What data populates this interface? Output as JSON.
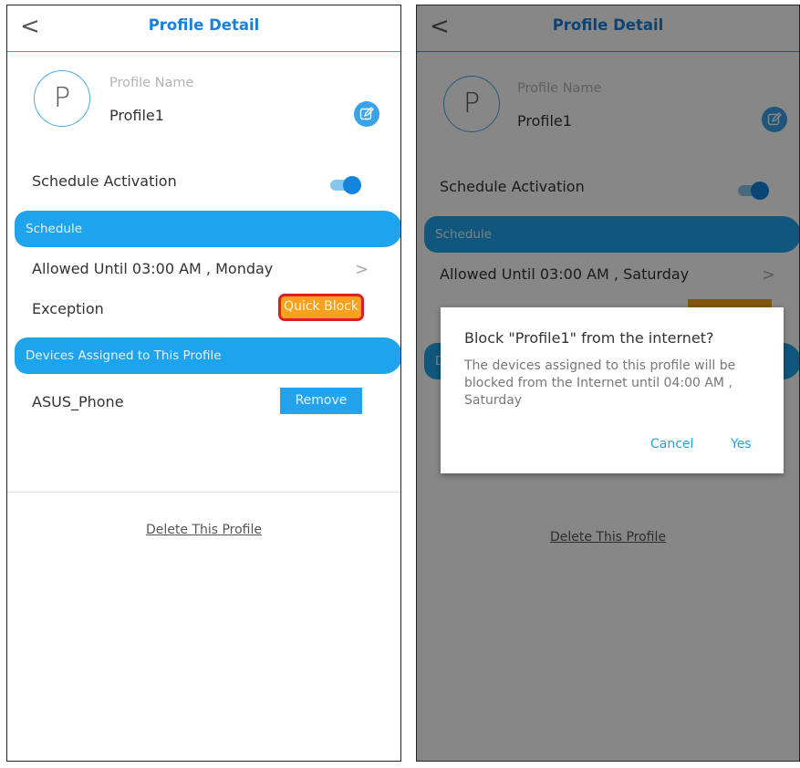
{
  "left": {
    "header": {
      "back_glyph": "<",
      "title": "Profile Detail"
    },
    "profile": {
      "avatar_letter": "P",
      "name_label": "Profile Name",
      "name_value": "Profile1",
      "edit_icon": "edit-icon"
    },
    "schedule_activation": {
      "label": "Schedule Activation",
      "enabled": true
    },
    "schedule_section": {
      "header": "Schedule",
      "allowed_until": "Allowed Until  03:00 AM , Monday",
      "chevron": ">"
    },
    "exception": {
      "label": "Exception",
      "button": "Quick Block"
    },
    "devices_section": {
      "header": "Devices Assigned to This Profile",
      "devices": [
        {
          "name": "ASUS_Phone",
          "action": "Remove"
        }
      ]
    },
    "delete_link": "Delete This Profile"
  },
  "right": {
    "header": {
      "back_glyph": "<",
      "title": "Profile Detail"
    },
    "profile": {
      "avatar_letter": "P",
      "name_label": "Profile Name",
      "name_value": "Profile1",
      "edit_icon": "edit-icon"
    },
    "schedule_activation": {
      "label": "Schedule Activation",
      "enabled": true
    },
    "schedule_section": {
      "header": "Schedule",
      "allowed_until": "Allowed Until  03:00 AM , Saturday",
      "chevron": ">"
    },
    "devices_section": {
      "header_initial": "D"
    },
    "delete_link": "Delete This Profile",
    "dialog": {
      "title": "Block \"Profile1\" from the internet?",
      "body": "The devices assigned to this profile will be blocked from the Internet until 04:00 AM , Saturday",
      "cancel": "Cancel",
      "confirm": "Yes"
    }
  },
  "colors": {
    "accent": "#1ea4ec",
    "title_blue": "#1b7fd6",
    "quick_block": "#f6a21c",
    "highlight_border": "#e01d24"
  }
}
